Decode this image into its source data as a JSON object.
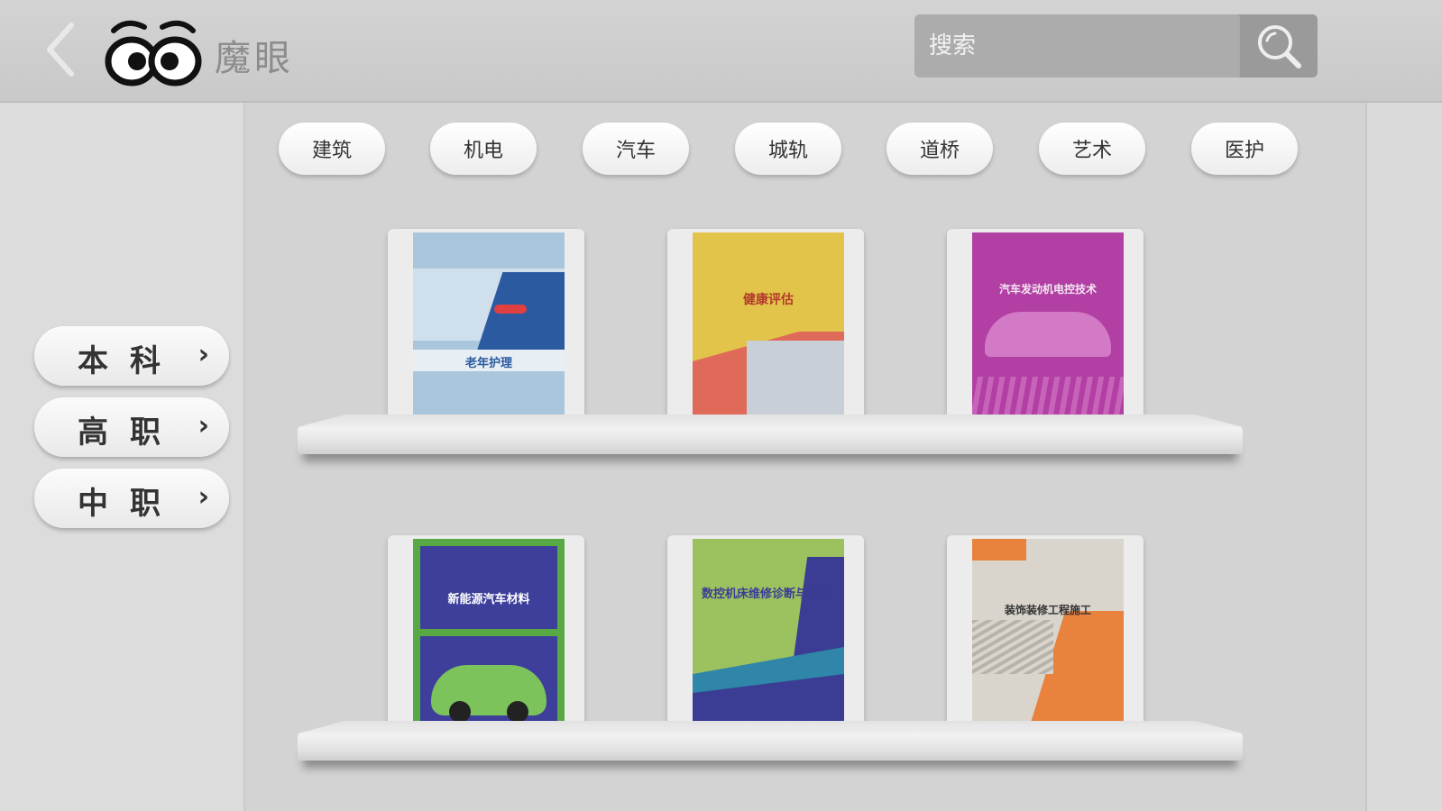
{
  "header": {
    "app_title": "魔眼",
    "back_icon": "chevron-left-icon",
    "logo_icon": "eyes-logo-icon",
    "search": {
      "placeholder": "搜索",
      "value": "",
      "icon": "search-icon"
    }
  },
  "sidebar": {
    "levels": [
      {
        "label": "本科",
        "arrow": "›"
      },
      {
        "label": "高职",
        "arrow": "›"
      },
      {
        "label": "中职",
        "arrow": "›"
      }
    ]
  },
  "categories": [
    "建筑",
    "机电",
    "汽车",
    "城轨",
    "道桥",
    "艺术",
    "医护"
  ],
  "books": [
    {
      "cover_title": "老年护理",
      "colors": [
        "#a9c6dc",
        "#2b5aa0"
      ]
    },
    {
      "cover_title": "健康评估",
      "colors": [
        "#e2c44a",
        "#e06a5a"
      ]
    },
    {
      "cover_title": "汽车发动机电控技术",
      "colors": [
        "#b23fa4",
        "#d37ac6"
      ]
    },
    {
      "cover_title": "新能源汽车材料",
      "colors": [
        "#3d3f9b",
        "#58a843"
      ]
    },
    {
      "cover_title": "数控机床维修诊断与维修",
      "colors": [
        "#9cc15f",
        "#3b3d94"
      ]
    },
    {
      "cover_title": "装饰装修工程施工",
      "colors": [
        "#d9d5cd",
        "#e8823d"
      ]
    }
  ],
  "colors": {
    "header_bg": "#cccccc",
    "search_bg": "#acacac",
    "pill_bg": "#ffffff",
    "text_dark": "#333333"
  }
}
